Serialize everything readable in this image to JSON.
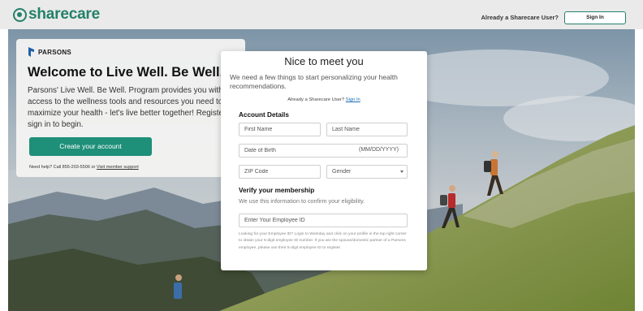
{
  "header": {
    "logo_text": "sharecare",
    "already_user": "Already a Sharecare User?",
    "sign_in_label": "Sign In"
  },
  "card": {
    "brand": "PARSONS",
    "title": "Welcome to Live Well. Be Well.",
    "description_lines": [
      "Parsons' Live Well. Be Well. Program provides you with",
      "access to the wellness tools and resources you need to",
      "maximize your health - let's live better together! Register",
      "sign in to begin."
    ],
    "create_button": "Create your account",
    "help_text": "Need help? Call 855-203-5506 or",
    "help_link": "Visit member support"
  },
  "modal": {
    "title": "Nice to meet you",
    "intro": "We need a few things to start personalizing your health recommendations.",
    "already_text": "Already a Sharecare User?",
    "sign_in_link": "Sign In",
    "account_details_heading": "Account Details",
    "first_name_placeholder": "First Name",
    "last_name_placeholder": "Last Name",
    "dob_placeholder": "Date of Birth",
    "dob_hint": "(MM/DD/YYYY)",
    "zip_placeholder": "ZIP Code",
    "gender_selected": "Gender",
    "verify_heading": "Verify your membership",
    "verify_sub": "We use this information to confirm your eligibility.",
    "employee_id_placeholder": "Enter Your Employee ID",
    "fine_print": "Looking for your Employee ID? Login to Workday and click on your profile in the top right corner to obtain your 5-digit employee ID number. If you are the spouse/domestic partner of a Parsons employee, please use their 5-digit employee ID to register."
  },
  "colors": {
    "brand_green": "#25806b",
    "button_green": "#1e8f78",
    "link_blue": "#1a6fb5"
  }
}
